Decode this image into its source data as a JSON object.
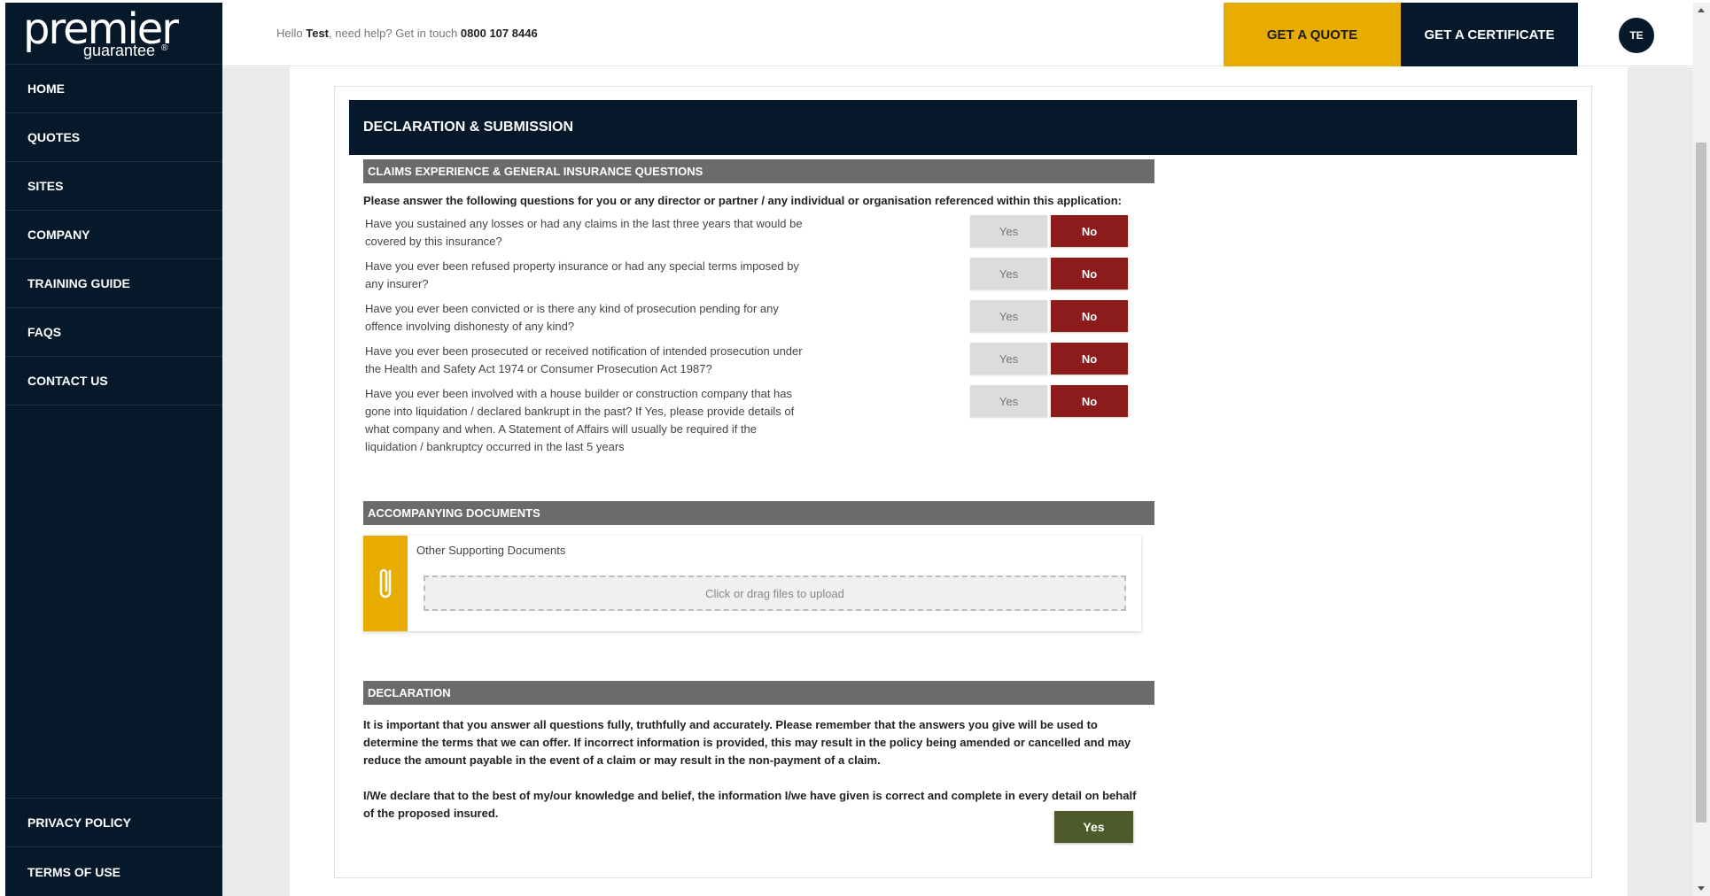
{
  "brand": {
    "name": "premier",
    "sub": "guarantee",
    "reg": "®"
  },
  "sidebar": {
    "items": [
      {
        "label": "HOME"
      },
      {
        "label": "QUOTES"
      },
      {
        "label": "SITES"
      },
      {
        "label": "COMPANY"
      },
      {
        "label": "TRAINING GUIDE"
      },
      {
        "label": "FAQS"
      },
      {
        "label": "CONTACT US"
      }
    ],
    "bottom": [
      {
        "label": "PRIVACY POLICY"
      },
      {
        "label": "TERMS OF USE"
      }
    ]
  },
  "header": {
    "hello": "Hello",
    "user": "Test",
    "help_text": ", need help? Get in touch",
    "phone": "0800 107 8446",
    "quote_label": "GET A QUOTE",
    "certificate_label": "GET A CERTIFICATE",
    "avatar": "TE"
  },
  "page": {
    "title": "DECLARATION & SUBMISSION",
    "claims_section": "CLAIMS EXPERIENCE & GENERAL INSURANCE QUESTIONS",
    "intro": "Please answer the following questions for you or any director or partner / any individual or organisation referenced within this application:",
    "questions": [
      {
        "text": "Have you sustained any losses or had any claims in the last three years that would be covered by this insurance?",
        "yes": "Yes",
        "no": "No",
        "selected": "No"
      },
      {
        "text": "Have you ever been refused property insurance or had any special terms imposed by any insurer?",
        "yes": "Yes",
        "no": "No",
        "selected": "No"
      },
      {
        "text": "Have you ever been convicted or is there any kind of prosecution pending for any offence involving dishonesty of any kind?",
        "yes": "Yes",
        "no": "No",
        "selected": "No"
      },
      {
        "text": "Have you ever been prosecuted or received notification of intended prosecution under the Health and Safety Act 1974 or Consumer Prosecution Act 1987?",
        "yes": "Yes",
        "no": "No",
        "selected": "No"
      },
      {
        "text": "Have you ever been involved with a house builder or construction company that has gone into liquidation / declared bankrupt in the past? If Yes, please provide details of what company and when. A Statement of Affairs will usually be required if the liquidation / bankruptcy occurred in the last 5 years",
        "yes": "Yes",
        "no": "No",
        "selected": "No"
      }
    ],
    "documents_section": "ACCOMPANYING DOCUMENTS",
    "upload_label": "Other Supporting Documents",
    "upload_hint": "Click or drag files to upload",
    "declaration_section": "DECLARATION",
    "declaration_p1": "It is important that you answer all questions fully, truthfully and accurately. Please remember that the answers you give will be used to determine the terms that we can offer. If incorrect information is provided, this may result in the policy being amended or cancelled and may reduce the amount payable in the event of a claim or may result in the non-payment of a claim.",
    "declaration_p2": "I/We declare that to the best of my/our knowledge and belief, the information I/we have given is correct and complete in every detail on behalf of the proposed insured.",
    "confirm_label": "Yes"
  },
  "colors": {
    "navy": "#06192a",
    "gold": "#e8ab00",
    "no_red": "#8c1b1b",
    "confirm_olive": "#4e5a2a",
    "section_grey": "#6b6b6b"
  }
}
